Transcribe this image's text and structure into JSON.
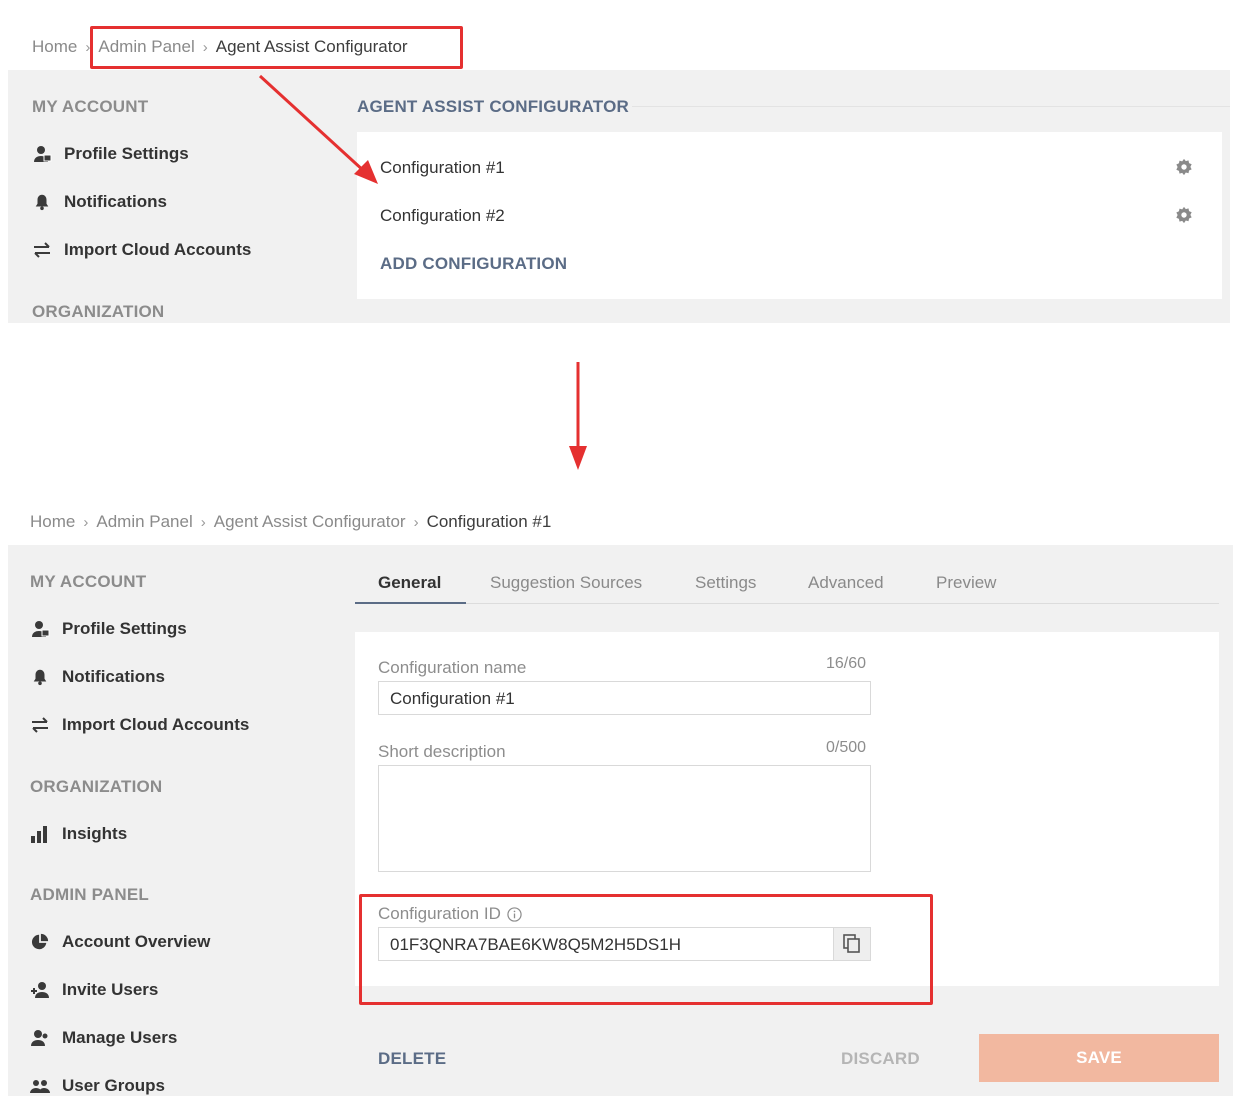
{
  "top": {
    "breadcrumb": {
      "home": "Home",
      "admin": "Admin Panel",
      "current": "Agent Assist Configurator"
    },
    "sidebar": {
      "my_account": "MY ACCOUNT",
      "items": [
        "Profile Settings",
        "Notifications",
        "Import Cloud Accounts"
      ],
      "organization": "ORGANIZATION"
    },
    "section_title": "AGENT ASSIST CONFIGURATOR",
    "configs": [
      "Configuration #1",
      "Configuration #2"
    ],
    "add_label": "ADD CONFIGURATION"
  },
  "bottom": {
    "breadcrumb": {
      "home": "Home",
      "admin": "Admin Panel",
      "configurator": "Agent Assist Configurator",
      "current": "Configuration #1"
    },
    "sidebar": {
      "my_account": "MY ACCOUNT",
      "account_items": [
        "Profile Settings",
        "Notifications",
        "Import Cloud Accounts"
      ],
      "organization": "ORGANIZATION",
      "org_items": [
        "Insights"
      ],
      "admin_panel": "ADMIN PANEL",
      "admin_items": [
        "Account Overview",
        "Invite Users",
        "Manage Users",
        "User Groups"
      ]
    },
    "tabs": [
      "General",
      "Suggestion Sources",
      "Settings",
      "Advanced",
      "Preview"
    ],
    "form": {
      "name_label": "Configuration name",
      "name_counter": "16/60",
      "name_value": "Configuration #1",
      "desc_label": "Short description",
      "desc_counter": "0/500",
      "desc_value": "",
      "id_label": "Configuration ID",
      "id_value": "01F3QNRA7BAE6KW8Q5M2H5DS1H"
    },
    "buttons": {
      "delete": "DELETE",
      "discard": "DISCARD",
      "save": "SAVE"
    }
  },
  "colors": {
    "highlight": "#e53030",
    "save_button": "#f2b8a0",
    "panel": "#f1f1f1",
    "link": "#5b6c86"
  },
  "icons": [
    "profile-icon",
    "bell-icon",
    "arrows-swap-icon",
    "bar-chart-icon",
    "pie-chart-icon",
    "add-user-icon",
    "users-icon",
    "user-groups-icon",
    "gear-icon",
    "info-icon",
    "copy-icon"
  ]
}
